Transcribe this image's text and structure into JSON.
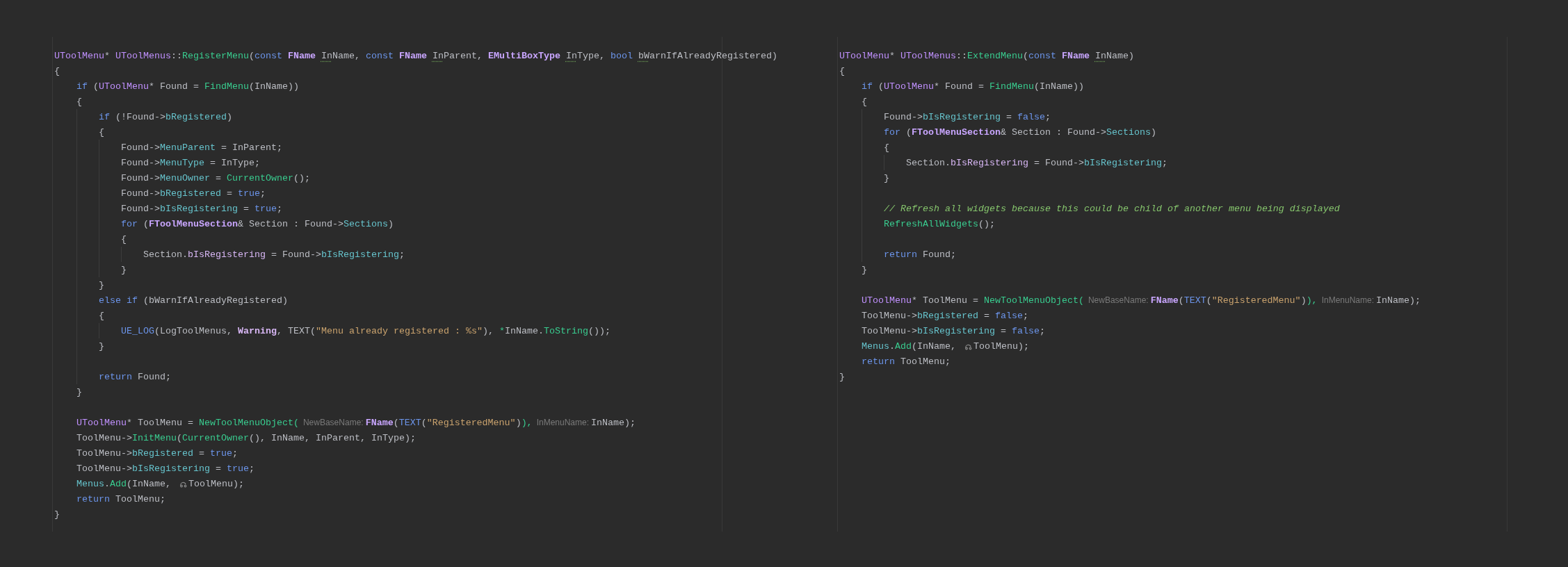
{
  "editor_panes": [
    {
      "lines": [
        {
          "kind": "code",
          "tokens": [
            {
              "kind": "type",
              "text": "UToolMenu"
            },
            {
              "kind": "plain",
              "text": "* "
            },
            {
              "kind": "type",
              "text": "UToolMenus"
            },
            {
              "kind": "plain",
              "text": "::"
            },
            {
              "kind": "fn",
              "text": "RegisterMenu"
            },
            {
              "kind": "plain",
              "text": "("
            },
            {
              "kind": "kw",
              "text": "const "
            },
            {
              "kind": "cls",
              "text": "FName "
            },
            {
              "kind": "flag",
              "text": "In"
            },
            {
              "kind": "plain",
              "text": "Name, "
            },
            {
              "kind": "kw",
              "text": "const "
            },
            {
              "kind": "cls",
              "text": "FName "
            },
            {
              "kind": "flag",
              "text": "In"
            },
            {
              "kind": "plain",
              "text": "Parent, "
            },
            {
              "kind": "cls",
              "text": "EMultiBoxType "
            },
            {
              "kind": "flag",
              "text": "In"
            },
            {
              "kind": "plain",
              "text": "Type, "
            },
            {
              "kind": "kw",
              "text": "bool "
            },
            {
              "kind": "flag",
              "text": "bW"
            },
            {
              "kind": "plain",
              "text": "arnIfAlreadyRegistered)"
            }
          ]
        },
        {
          "kind": "code",
          "tokens": [
            {
              "kind": "plain",
              "text": "{"
            }
          ],
          "children": [
            {
              "kind": "code",
              "tokens": [
                {
                  "kind": "kw",
                  "text": "if"
                },
                {
                  "kind": "plain",
                  "text": " ("
                },
                {
                  "kind": "type",
                  "text": "UToolMenu"
                },
                {
                  "kind": "plain",
                  "text": "* Found = "
                },
                {
                  "kind": "fn",
                  "text": "FindMenu"
                },
                {
                  "kind": "plain",
                  "text": "(InName))"
                }
              ]
            },
            {
              "kind": "code",
              "tokens": [
                {
                  "kind": "plain",
                  "text": "{"
                }
              ],
              "children": [
                {
                  "kind": "code",
                  "tokens": [
                    {
                      "kind": "kw",
                      "text": "if"
                    },
                    {
                      "kind": "plain",
                      "text": " (!Found->"
                    },
                    {
                      "kind": "field",
                      "text": "bRegistered"
                    },
                    {
                      "kind": "plain",
                      "text": ")"
                    }
                  ]
                },
                {
                  "kind": "code",
                  "tokens": [
                    {
                      "kind": "plain",
                      "text": "{"
                    }
                  ],
                  "children": [
                    {
                      "kind": "code",
                      "tokens": [
                        {
                          "kind": "plain",
                          "text": "Found->"
                        },
                        {
                          "kind": "field",
                          "text": "MenuParent"
                        },
                        {
                          "kind": "plain",
                          "text": " = InParent;"
                        }
                      ]
                    },
                    {
                      "kind": "code",
                      "tokens": [
                        {
                          "kind": "plain",
                          "text": "Found->"
                        },
                        {
                          "kind": "field",
                          "text": "MenuType"
                        },
                        {
                          "kind": "plain",
                          "text": " = InType;"
                        }
                      ]
                    },
                    {
                      "kind": "code",
                      "tokens": [
                        {
                          "kind": "plain",
                          "text": "Found->"
                        },
                        {
                          "kind": "field",
                          "text": "MenuOwner"
                        },
                        {
                          "kind": "plain",
                          "text": " = "
                        },
                        {
                          "kind": "fn",
                          "text": "CurrentOwner"
                        },
                        {
                          "kind": "plain",
                          "text": "();"
                        }
                      ]
                    },
                    {
                      "kind": "code",
                      "tokens": [
                        {
                          "kind": "plain",
                          "text": "Found->"
                        },
                        {
                          "kind": "field",
                          "text": "bRegistered"
                        },
                        {
                          "kind": "plain",
                          "text": " = "
                        },
                        {
                          "kind": "kw",
                          "text": "true"
                        },
                        {
                          "kind": "plain",
                          "text": ";"
                        }
                      ]
                    },
                    {
                      "kind": "code",
                      "tokens": [
                        {
                          "kind": "plain",
                          "text": "Found->"
                        },
                        {
                          "kind": "field",
                          "text": "bIsRegistering"
                        },
                        {
                          "kind": "plain",
                          "text": " = "
                        },
                        {
                          "kind": "kw",
                          "text": "true"
                        },
                        {
                          "kind": "plain",
                          "text": ";"
                        }
                      ]
                    },
                    {
                      "kind": "code",
                      "tokens": [
                        {
                          "kind": "kw",
                          "text": "for"
                        },
                        {
                          "kind": "plain",
                          "text": " ("
                        },
                        {
                          "kind": "cls",
                          "text": "FToolMenuSection"
                        },
                        {
                          "kind": "plain",
                          "text": "& Section : Found->"
                        },
                        {
                          "kind": "field",
                          "text": "Sections"
                        },
                        {
                          "kind": "plain",
                          "text": ")"
                        }
                      ]
                    },
                    {
                      "kind": "code",
                      "tokens": [
                        {
                          "kind": "plain",
                          "text": "{"
                        }
                      ],
                      "children": [
                        {
                          "kind": "code",
                          "tokens": [
                            {
                              "kind": "plain",
                              "text": "Section."
                            },
                            {
                              "kind": "member",
                              "text": "bIsRegistering"
                            },
                            {
                              "kind": "plain",
                              "text": " = Found->"
                            },
                            {
                              "kind": "field",
                              "text": "bIsRegistering"
                            },
                            {
                              "kind": "plain",
                              "text": ";"
                            }
                          ]
                        }
                      ]
                    },
                    {
                      "kind": "code",
                      "tokens": [
                        {
                          "kind": "plain",
                          "text": "}"
                        }
                      ]
                    }
                  ]
                },
                {
                  "kind": "code",
                  "tokens": [
                    {
                      "kind": "plain",
                      "text": "}"
                    }
                  ]
                },
                {
                  "kind": "code",
                  "tokens": [
                    {
                      "kind": "kw",
                      "text": "else if"
                    },
                    {
                      "kind": "plain",
                      "text": " (bWarnIfAlreadyRegistered)"
                    }
                  ]
                },
                {
                  "kind": "code",
                  "tokens": [
                    {
                      "kind": "plain",
                      "text": "{"
                    }
                  ],
                  "children": [
                    {
                      "kind": "code",
                      "tokens": [
                        {
                          "kind": "kw",
                          "text": "UE_LOG"
                        },
                        {
                          "kind": "plain",
                          "text": "(LogToolMenus, "
                        },
                        {
                          "kind": "enum",
                          "text": "Warning"
                        },
                        {
                          "kind": "plain",
                          "text": ", TEXT("
                        },
                        {
                          "kind": "str",
                          "text": "\"Menu already registered : %s\""
                        },
                        {
                          "kind": "plain",
                          "text": "), "
                        },
                        {
                          "kind": "fn",
                          "text": "*"
                        },
                        {
                          "kind": "plain",
                          "text": "InName."
                        },
                        {
                          "kind": "fn",
                          "text": "ToString"
                        },
                        {
                          "kind": "plain",
                          "text": "());"
                        }
                      ]
                    }
                  ]
                },
                {
                  "kind": "code",
                  "tokens": [
                    {
                      "kind": "plain",
                      "text": "}"
                    }
                  ]
                },
                {
                  "kind": "blank"
                },
                {
                  "kind": "code",
                  "tokens": [
                    {
                      "kind": "kw",
                      "text": "return"
                    },
                    {
                      "kind": "plain",
                      "text": " Found;"
                    }
                  ]
                }
              ]
            },
            {
              "kind": "code",
              "tokens": [
                {
                  "kind": "plain",
                  "text": "}"
                }
              ]
            },
            {
              "kind": "blank"
            },
            {
              "kind": "code",
              "tokens": [
                {
                  "kind": "type",
                  "text": "UToolMenu"
                },
                {
                  "kind": "plain",
                  "text": "* ToolMenu = "
                },
                {
                  "kind": "fn",
                  "text": "NewToolMenuObject("
                },
                {
                  "kind": "hint",
                  "text": "NewBaseName:"
                },
                {
                  "kind": "cls",
                  "text": "FName"
                },
                {
                  "kind": "plain",
                  "text": "("
                },
                {
                  "kind": "kw",
                  "text": "TEXT"
                },
                {
                  "kind": "plain",
                  "text": "("
                },
                {
                  "kind": "str",
                  "text": "\"RegisteredMenu\""
                },
                {
                  "kind": "plain",
                  "text": ")"
                },
                {
                  "kind": "fn",
                  "text": "),"
                },
                {
                  "kind": "hint",
                  "text": "InMenuName:"
                },
                {
                  "kind": "plain",
                  "text": "InName);"
                }
              ]
            },
            {
              "kind": "code",
              "tokens": [
                {
                  "kind": "plain",
                  "text": "ToolMenu->"
                },
                {
                  "kind": "fn",
                  "text": "InitMenu"
                },
                {
                  "kind": "plain",
                  "text": "("
                },
                {
                  "kind": "fn",
                  "text": "CurrentOwner"
                },
                {
                  "kind": "plain",
                  "text": "(), InName, InParent, InType);"
                }
              ]
            },
            {
              "kind": "code",
              "tokens": [
                {
                  "kind": "plain",
                  "text": "ToolMenu->"
                },
                {
                  "kind": "field",
                  "text": "bRegistered"
                },
                {
                  "kind": "plain",
                  "text": " = "
                },
                {
                  "kind": "kw",
                  "text": "true"
                },
                {
                  "kind": "plain",
                  "text": ";"
                }
              ]
            },
            {
              "kind": "code",
              "tokens": [
                {
                  "kind": "plain",
                  "text": "ToolMenu->"
                },
                {
                  "kind": "field",
                  "text": "bIsRegistering"
                },
                {
                  "kind": "plain",
                  "text": " = "
                },
                {
                  "kind": "kw",
                  "text": "true"
                },
                {
                  "kind": "plain",
                  "text": ";"
                }
              ]
            },
            {
              "kind": "code",
              "tokens": [
                {
                  "kind": "field",
                  "text": "Menus"
                },
                {
                  "kind": "plain",
                  "text": "."
                },
                {
                  "kind": "fn",
                  "text": "Add"
                },
                {
                  "kind": "plain",
                  "text": "(InName, "
                },
                {
                  "kind": "move_icon"
                },
                {
                  "kind": "plain",
                  "text": "ToolMenu);"
                }
              ]
            },
            {
              "kind": "code",
              "tokens": [
                {
                  "kind": "kw",
                  "text": "return"
                },
                {
                  "kind": "plain",
                  "text": " ToolMenu;"
                }
              ]
            }
          ]
        },
        {
          "kind": "code",
          "tokens": [
            {
              "kind": "plain",
              "text": "}"
            }
          ]
        }
      ]
    },
    {
      "lines": [
        {
          "kind": "code",
          "tokens": [
            {
              "kind": "type",
              "text": "UToolMenu"
            },
            {
              "kind": "plain",
              "text": "* "
            },
            {
              "kind": "type",
              "text": "UToolMenus"
            },
            {
              "kind": "plain",
              "text": "::"
            },
            {
              "kind": "fn",
              "text": "ExtendMenu"
            },
            {
              "kind": "plain",
              "text": "("
            },
            {
              "kind": "kw",
              "text": "const "
            },
            {
              "kind": "cls",
              "text": "FName "
            },
            {
              "kind": "flag",
              "text": "In"
            },
            {
              "kind": "plain",
              "text": "Name)"
            }
          ]
        },
        {
          "kind": "code",
          "tokens": [
            {
              "kind": "plain",
              "text": "{"
            }
          ],
          "children": [
            {
              "kind": "code",
              "tokens": [
                {
                  "kind": "kw",
                  "text": "if"
                },
                {
                  "kind": "plain",
                  "text": " ("
                },
                {
                  "kind": "type",
                  "text": "UToolMenu"
                },
                {
                  "kind": "plain",
                  "text": "* Found = "
                },
                {
                  "kind": "fn",
                  "text": "FindMenu"
                },
                {
                  "kind": "plain",
                  "text": "(InName))"
                }
              ]
            },
            {
              "kind": "code",
              "tokens": [
                {
                  "kind": "plain",
                  "text": "{"
                }
              ],
              "children": [
                {
                  "kind": "code",
                  "tokens": [
                    {
                      "kind": "plain",
                      "text": "Found->"
                    },
                    {
                      "kind": "field",
                      "text": "bIsRegistering"
                    },
                    {
                      "kind": "plain",
                      "text": " = "
                    },
                    {
                      "kind": "kw",
                      "text": "false"
                    },
                    {
                      "kind": "plain",
                      "text": ";"
                    }
                  ]
                },
                {
                  "kind": "code",
                  "tokens": [
                    {
                      "kind": "kw",
                      "text": "for"
                    },
                    {
                      "kind": "plain",
                      "text": " ("
                    },
                    {
                      "kind": "cls",
                      "text": "FToolMenuSection"
                    },
                    {
                      "kind": "plain",
                      "text": "& Section : Found->"
                    },
                    {
                      "kind": "field",
                      "text": "Sections"
                    },
                    {
                      "kind": "plain",
                      "text": ")"
                    }
                  ]
                },
                {
                  "kind": "code",
                  "tokens": [
                    {
                      "kind": "plain",
                      "text": "{"
                    }
                  ],
                  "children": [
                    {
                      "kind": "code",
                      "tokens": [
                        {
                          "kind": "plain",
                          "text": "Section."
                        },
                        {
                          "kind": "member",
                          "text": "bIsRegistering"
                        },
                        {
                          "kind": "plain",
                          "text": " = Found->"
                        },
                        {
                          "kind": "field",
                          "text": "bIsRegistering"
                        },
                        {
                          "kind": "plain",
                          "text": ";"
                        }
                      ]
                    }
                  ]
                },
                {
                  "kind": "code",
                  "tokens": [
                    {
                      "kind": "plain",
                      "text": "}"
                    }
                  ]
                },
                {
                  "kind": "blank"
                },
                {
                  "kind": "code",
                  "tokens": [
                    {
                      "kind": "comment",
                      "text": "// Refresh all widgets because this could be child of another menu being displayed"
                    }
                  ]
                },
                {
                  "kind": "code",
                  "tokens": [
                    {
                      "kind": "fn",
                      "text": "RefreshAllWidgets"
                    },
                    {
                      "kind": "plain",
                      "text": "();"
                    }
                  ]
                },
                {
                  "kind": "blank"
                },
                {
                  "kind": "code",
                  "tokens": [
                    {
                      "kind": "kw",
                      "text": "return"
                    },
                    {
                      "kind": "plain",
                      "text": " Found;"
                    }
                  ]
                }
              ]
            },
            {
              "kind": "code",
              "tokens": [
                {
                  "kind": "plain",
                  "text": "}"
                }
              ]
            },
            {
              "kind": "blank"
            },
            {
              "kind": "code",
              "tokens": [
                {
                  "kind": "type",
                  "text": "UToolMenu"
                },
                {
                  "kind": "plain",
                  "text": "* ToolMenu = "
                },
                {
                  "kind": "fn",
                  "text": "NewToolMenuObject("
                },
                {
                  "kind": "hint",
                  "text": "NewBaseName:"
                },
                {
                  "kind": "cls",
                  "text": "FName"
                },
                {
                  "kind": "plain",
                  "text": "("
                },
                {
                  "kind": "kw",
                  "text": "TEXT"
                },
                {
                  "kind": "plain",
                  "text": "("
                },
                {
                  "kind": "str",
                  "text": "\"RegisteredMenu\""
                },
                {
                  "kind": "plain",
                  "text": ")"
                },
                {
                  "kind": "fn",
                  "text": "),"
                },
                {
                  "kind": "hint",
                  "text": "InMenuName:"
                },
                {
                  "kind": "plain",
                  "text": "InName);"
                }
              ]
            },
            {
              "kind": "code",
              "tokens": [
                {
                  "kind": "plain",
                  "text": "ToolMenu->"
                },
                {
                  "kind": "field",
                  "text": "bRegistered"
                },
                {
                  "kind": "plain",
                  "text": " = "
                },
                {
                  "kind": "kw",
                  "text": "false"
                },
                {
                  "kind": "plain",
                  "text": ";"
                }
              ]
            },
            {
              "kind": "code",
              "tokens": [
                {
                  "kind": "plain",
                  "text": "ToolMenu->"
                },
                {
                  "kind": "field",
                  "text": "bIsRegistering"
                },
                {
                  "kind": "plain",
                  "text": " = "
                },
                {
                  "kind": "kw",
                  "text": "false"
                },
                {
                  "kind": "plain",
                  "text": ";"
                }
              ]
            },
            {
              "kind": "code",
              "tokens": [
                {
                  "kind": "field",
                  "text": "Menus"
                },
                {
                  "kind": "plain",
                  "text": "."
                },
                {
                  "kind": "fn",
                  "text": "Add"
                },
                {
                  "kind": "plain",
                  "text": "(InName, "
                },
                {
                  "kind": "move_icon"
                },
                {
                  "kind": "plain",
                  "text": "ToolMenu);"
                }
              ]
            },
            {
              "kind": "code",
              "tokens": [
                {
                  "kind": "kw",
                  "text": "return"
                },
                {
                  "kind": "plain",
                  "text": " ToolMenu;"
                }
              ]
            }
          ]
        },
        {
          "kind": "code",
          "tokens": [
            {
              "kind": "plain",
              "text": "}"
            }
          ]
        }
      ]
    }
  ]
}
